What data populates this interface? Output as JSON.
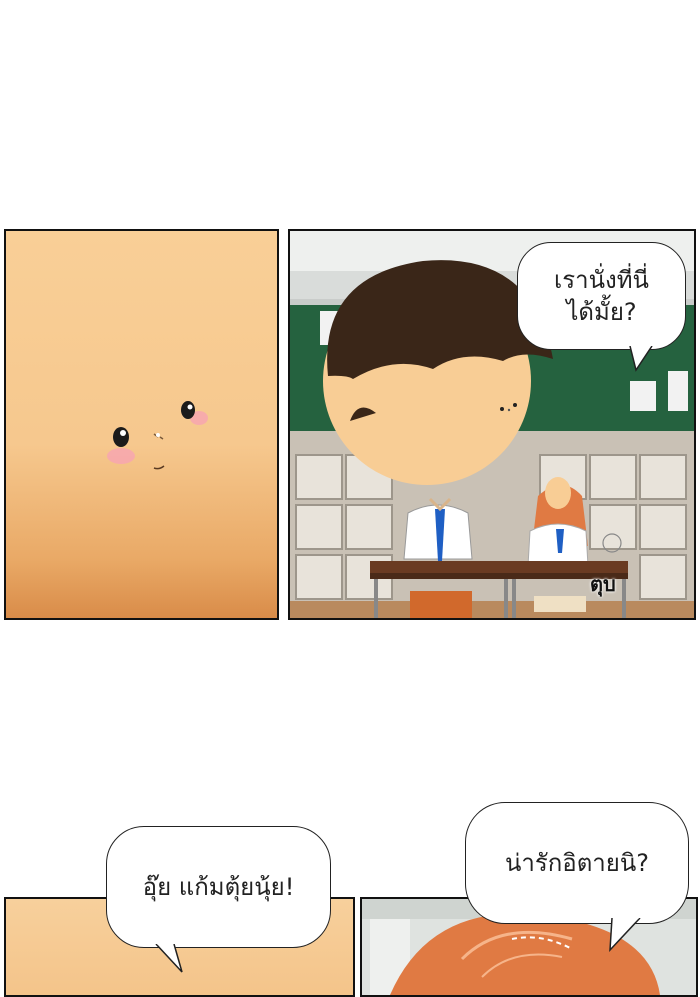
{
  "panels": {
    "panel1": {
      "description_icon": "blushing-face-closeup"
    },
    "panel2": {
      "speech": "เรานั่งที่นี่\nได้มั้ย?",
      "sfx": "ตุบ"
    },
    "panel3": {
      "speech": "อุ๊ย  แก้มตุ้ยนุ้ย!"
    },
    "panel4": {
      "speech": "น่ารักอิตายนิ?"
    }
  },
  "colors": {
    "skin": "#f8cd95",
    "hair_dark": "#3a2618",
    "chalkboard": "#25623f",
    "hair_orange": "#e07a43",
    "tie_blue": "#1f5fc4",
    "blush": "#f7a6b0"
  }
}
